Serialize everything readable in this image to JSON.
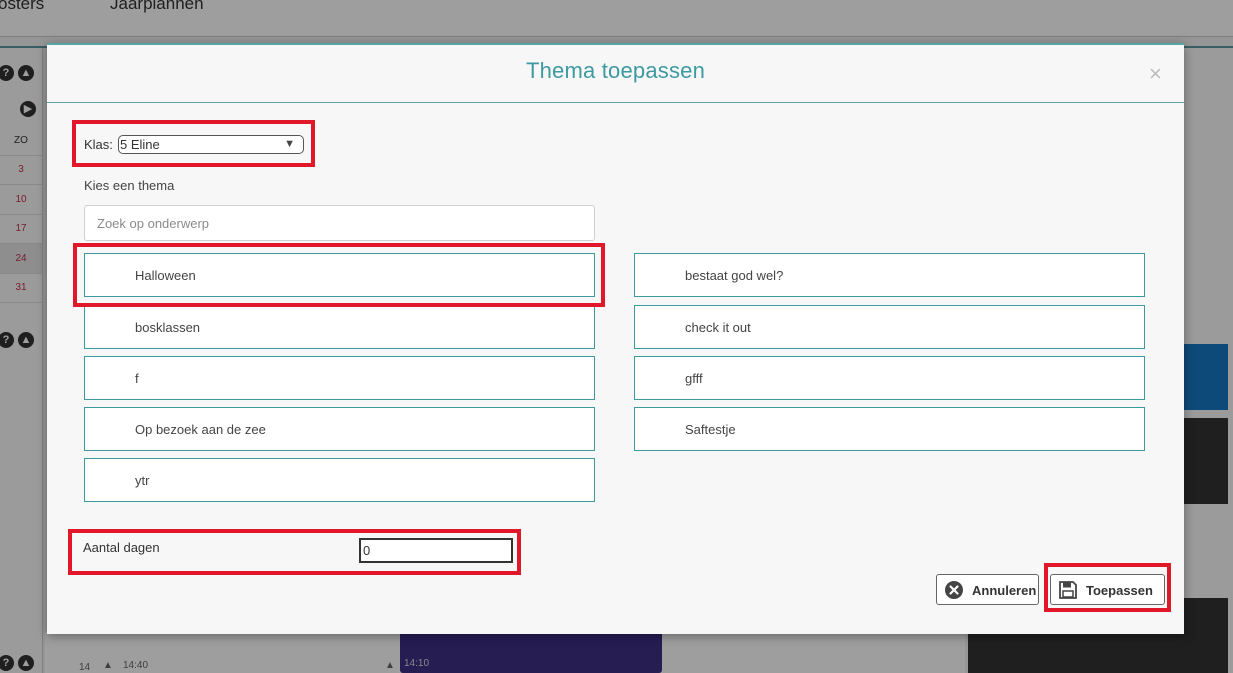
{
  "background": {
    "nav_items": [
      "osters",
      "Jaarplannen"
    ],
    "day_header": "ZO",
    "day_numbers": [
      "3",
      "10",
      "17",
      "24",
      "31"
    ],
    "bottom_row_number": "14",
    "bottom_time_1": "14:40",
    "event_time": "14:10"
  },
  "modal": {
    "title": "Thema toepassen",
    "close_label": "×",
    "klas_label": "Klas:",
    "klas_value": "5 Eline",
    "kies_label": "Kies een thema",
    "search_placeholder": "Zoek op onderwerp",
    "themes_left": [
      "Halloween",
      "bosklassen",
      "f",
      "Op bezoek aan de zee",
      "ytr"
    ],
    "themes_right": [
      "bestaat god wel?",
      "check it out",
      "gfff",
      "Saftestje"
    ],
    "aantal_dagen_label": "Aantal dagen",
    "aantal_dagen_value": "0",
    "cancel_label": "Annuleren",
    "apply_label": "Toepassen"
  },
  "colors": {
    "accent": "#3d9aa0",
    "highlight": "#e0182a"
  }
}
